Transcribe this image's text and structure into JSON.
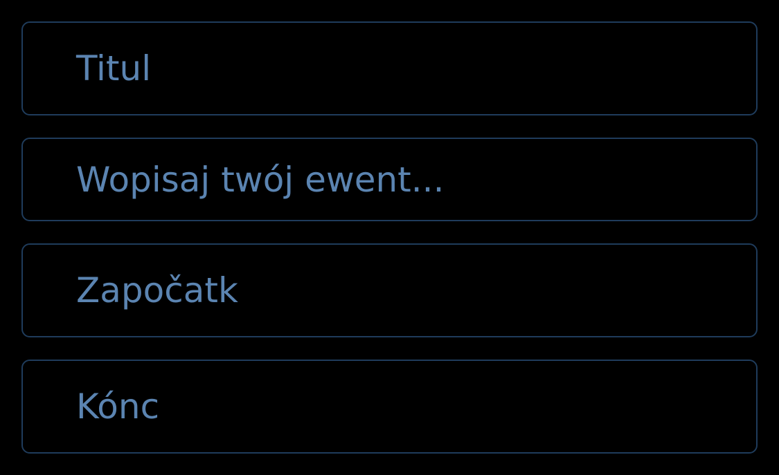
{
  "form": {
    "title_field": {
      "placeholder": "Titul",
      "value": ""
    },
    "description_field": {
      "placeholder": "Wopisaj twój ewent...",
      "value": ""
    },
    "start_field": {
      "placeholder": "Započatk",
      "value": ""
    },
    "end_field": {
      "placeholder": "Kónc",
      "value": ""
    }
  },
  "colors": {
    "background": "#000000",
    "field_border": "#1f3c5c",
    "placeholder_text": "#5b84b1"
  }
}
